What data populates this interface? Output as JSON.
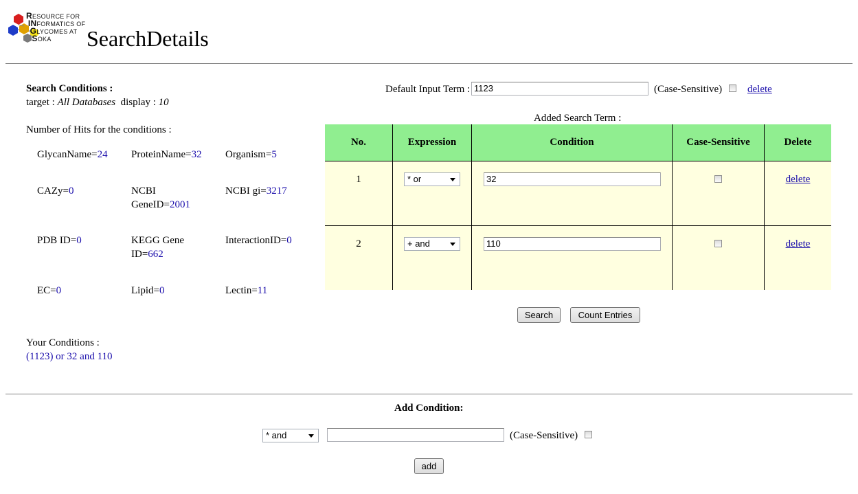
{
  "logo": {
    "lines": [
      {
        "cap": "R",
        "rest": "ESOURCE FOR"
      },
      {
        "cap": "IN",
        "rest": "FORMATICS OF"
      },
      {
        "cap": "G",
        "rest": "LYCOMES AT"
      },
      {
        "cap": "S",
        "rest": "OKA"
      }
    ]
  },
  "page_title": "SearchDetails",
  "search_conditions": {
    "heading": "Search Conditions :",
    "target_label": "target : ",
    "target_value": "All Databases",
    "display_label": "display : ",
    "display_value": "10"
  },
  "hits": {
    "heading": "Number of Hits for the conditions :",
    "items": [
      {
        "name": "GlycanName=",
        "count": "24"
      },
      {
        "name": "ProteinName=",
        "count": "32"
      },
      {
        "name": "Organism=",
        "count": "5"
      },
      {
        "name": "CAZy=",
        "count": "0"
      },
      {
        "name": "NCBI GeneID=",
        "count": "2001"
      },
      {
        "name": "NCBI gi=",
        "count": "3217"
      },
      {
        "name": "PDB ID=",
        "count": "0"
      },
      {
        "name": "KEGG Gene ID=",
        "count": "662"
      },
      {
        "name": "InteractionID=",
        "count": "0"
      },
      {
        "name": "EC=",
        "count": "0"
      },
      {
        "name": "Lipid=",
        "count": "0"
      },
      {
        "name": "Lectin=",
        "count": "11"
      }
    ]
  },
  "your_conditions": {
    "heading": "Your Conditions :",
    "value": "(1123) or 32 and 110"
  },
  "default_term": {
    "label": "Default Input Term :",
    "value": "1123",
    "case_label": "(Case-Sensitive)",
    "delete_label": "delete"
  },
  "added_terms": {
    "heading": "Added Search Term :",
    "columns": [
      "No.",
      "Expression",
      "Condition",
      "Case-Sensitive",
      "Delete"
    ],
    "rows": [
      {
        "no": "1",
        "expression": "* or",
        "condition": "32",
        "delete": "delete"
      },
      {
        "no": "2",
        "expression": "+ and",
        "condition": "110",
        "delete": "delete"
      }
    ]
  },
  "buttons": {
    "search": "Search",
    "count": "Count Entries",
    "add": "add"
  },
  "add_condition": {
    "heading": "Add Condition:",
    "expression": "* and",
    "value": "",
    "case_label": "(Case-Sensitive)"
  },
  "colors": {
    "header_bg": "#90ee90",
    "row_bg": "#ffffe0",
    "link": "#1a0dab"
  }
}
